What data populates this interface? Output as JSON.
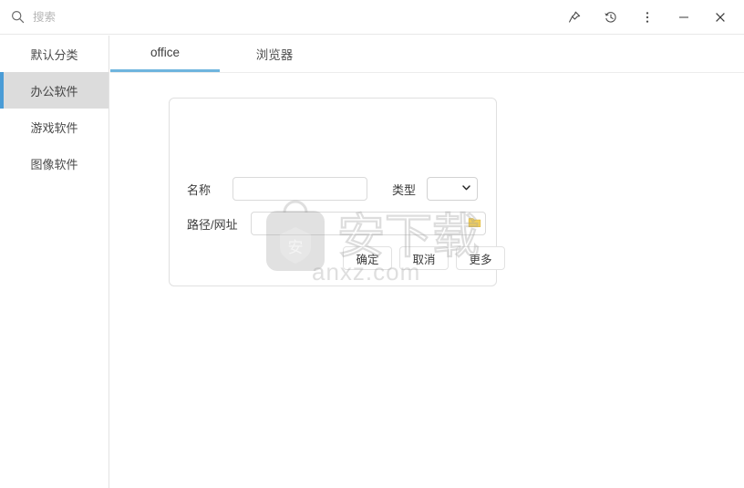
{
  "titlebar": {
    "search_placeholder": "搜索",
    "search_value": "",
    "icons": {
      "search": "search-icon",
      "pin": "pin-icon",
      "history": "history-icon",
      "more": "more-vertical-icon",
      "minimize": "minimize-icon",
      "close": "close-icon"
    },
    "minimize_label": "",
    "close_label": ""
  },
  "sidebar": {
    "items": [
      {
        "label": "默认分类",
        "active": false
      },
      {
        "label": "办公软件",
        "active": true
      },
      {
        "label": "游戏软件",
        "active": false
      },
      {
        "label": "图像软件",
        "active": false
      }
    ]
  },
  "tabs": [
    {
      "label": "office",
      "active": true
    },
    {
      "label": "浏览器",
      "active": false
    }
  ],
  "dialog": {
    "name": {
      "label": "名称",
      "value": "",
      "placeholder": ""
    },
    "type": {
      "label": "类型",
      "value": "",
      "options": []
    },
    "path": {
      "label": "路径/网址",
      "value": "",
      "placeholder": "",
      "browse_icon": "folder-icon"
    },
    "buttons": {
      "confirm": "确定",
      "cancel": "取消",
      "more": "更多"
    }
  },
  "watermark": {
    "text": "安下载",
    "subtext": "anxz.com",
    "logo_char": "安"
  },
  "colors": {
    "accent": "#6fb5de",
    "sidebar_active_bar": "#4a9cd6",
    "sidebar_active_bg": "#dcdcdc",
    "folder_yellow": "#f2cf5b",
    "border": "#e0e0e0"
  }
}
